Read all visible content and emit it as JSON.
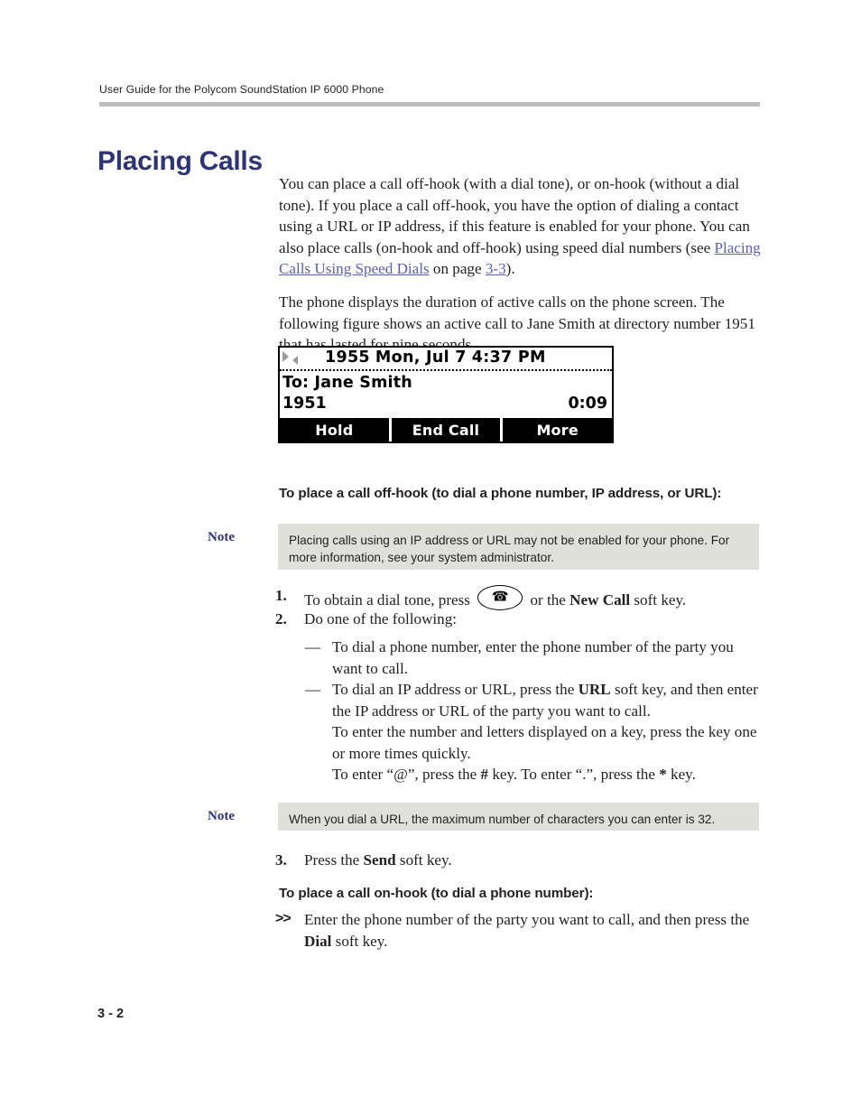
{
  "header": {
    "running_head": "User Guide for the Polycom SoundStation IP 6000 Phone"
  },
  "title": "Placing Calls",
  "intro": {
    "paragraph1_part1": "You can place a call off-hook (with a dial tone), or on-hook (without a dial tone). If you place a call off-hook, you have the option of dialing a contact using a URL or IP address, if this feature is enabled for your phone. You can also place calls (on-hook and off-hook) using speed dial numbers (see ",
    "link_text": "Placing Calls Using Speed Dials",
    "paragraph1_part2": " on page ",
    "page_ref": "3-3",
    "paragraph1_part3": ").",
    "paragraph2": "The phone displays the duration of active calls on the phone screen. The following figure shows an active call to Jane Smith at directory number 1951 that has lasted for nine seconds."
  },
  "figure": {
    "status_line": "1955  Mon, Jul 7   4:37 PM",
    "extension": "1955",
    "date": "Mon, Jul 7",
    "time": "4:37 PM",
    "call_to_label": "To: Jane Smith",
    "directory_number": "1951",
    "duration": "0:09",
    "softkeys": [
      {
        "label": "Hold"
      },
      {
        "label": "End Call"
      },
      {
        "label": "More"
      }
    ],
    "icons": {
      "arrow_right": "play-arrow-icon",
      "arrow_left": "back-arrow-icon"
    }
  },
  "sections": [
    {
      "heading": "To place a call off-hook (to dial a phone number, IP address, or URL):"
    },
    {
      "heading": "To place a call on-hook (to dial a phone number):"
    }
  ],
  "notes": [
    {
      "label": "Note",
      "text": "Placing calls using an IP address or URL may not be enabled for your phone. For more information, see your system administrator."
    },
    {
      "label": "Note",
      "text": "When you dial a URL, the maximum number of characters you can enter is 32."
    }
  ],
  "steps": {
    "step1": {
      "number": "1.",
      "text_before": "To obtain a dial tone, press ",
      "key_icon": "phone-handset-icon",
      "text_middle": " or the ",
      "bold_term": "New Call",
      "text_after": " soft key."
    },
    "step2": {
      "number": "2.",
      "text": "Do one of the following:"
    },
    "step3": {
      "number": "3.",
      "text_before": "Press the ",
      "bold_term": "Send",
      "text_after": " soft key."
    },
    "step_arrow": {
      "marker": ">>",
      "text_before": "Enter the phone number of the party you want to call, and then press the ",
      "bold_term": "Dial",
      "text_after": " soft key."
    }
  },
  "bullets": {
    "dash1": {
      "marker": "—",
      "text": "To dial a phone number, enter the phone number of the party you want to call."
    },
    "dash2": {
      "marker": "—",
      "text_before": "To dial an IP address or URL, press the ",
      "bold_term": "URL",
      "text_after": " soft key, and then enter the IP address or URL of the party you want to call."
    },
    "sub1": "To enter the number and letters displayed on a key, press the key one or more times quickly.",
    "sub2_before": "To enter “@”, press the ",
    "sub2_bold1": "#",
    "sub2_middle": " key. To enter “.”, press the ",
    "sub2_bold2": "*",
    "sub2_after": " key."
  },
  "footer": {
    "page_number": "3 - 2"
  },
  "colors": {
    "title_blue": "#2e3475",
    "link_blue": "#5a5faf",
    "note_bg": "#dfe0da",
    "rule_gray": "#bcbcbc"
  }
}
